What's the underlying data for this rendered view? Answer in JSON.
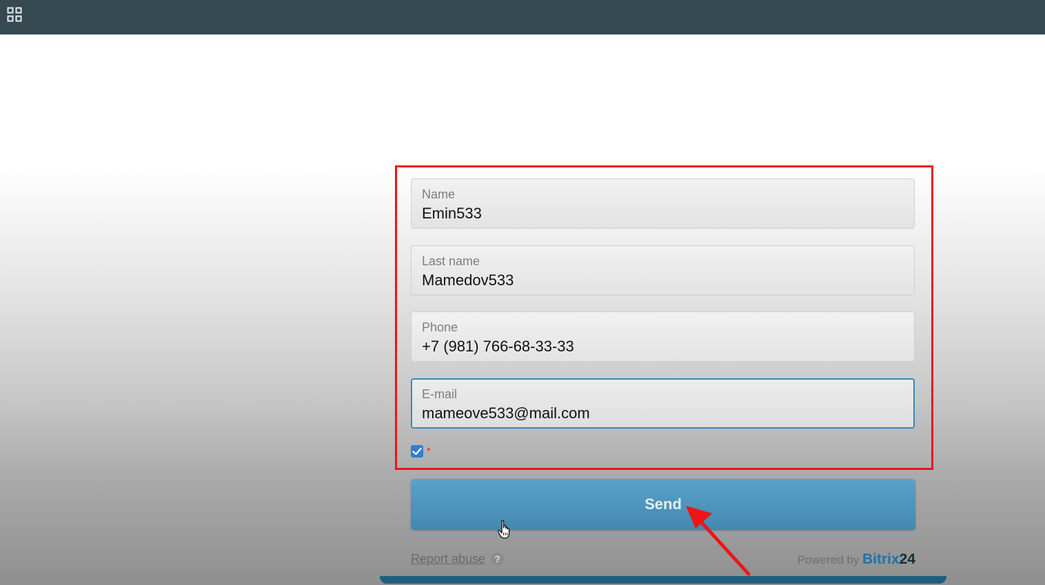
{
  "topbar": {
    "background_color": "#344a50",
    "apps_icon": "grid-icon"
  },
  "form": {
    "fields": [
      {
        "label": "Name",
        "value": "Emin533"
      },
      {
        "label": "Last name",
        "value": "Mamedov533"
      },
      {
        "label": "Phone",
        "value": "+7 (981) 766-68-33-33"
      },
      {
        "label": "E-mail",
        "value": "mameove533@mail.com"
      }
    ],
    "consent_checked": true,
    "required_marker": "*",
    "submit_label": "Send",
    "button_color": "#4f97bf"
  },
  "footer": {
    "report_abuse": "Report abuse",
    "help_icon": "?",
    "powered_by": "Powered by",
    "brand_name": "Bitrix",
    "brand_number": "24"
  },
  "annotation": {
    "highlight_color": "#f01414"
  }
}
